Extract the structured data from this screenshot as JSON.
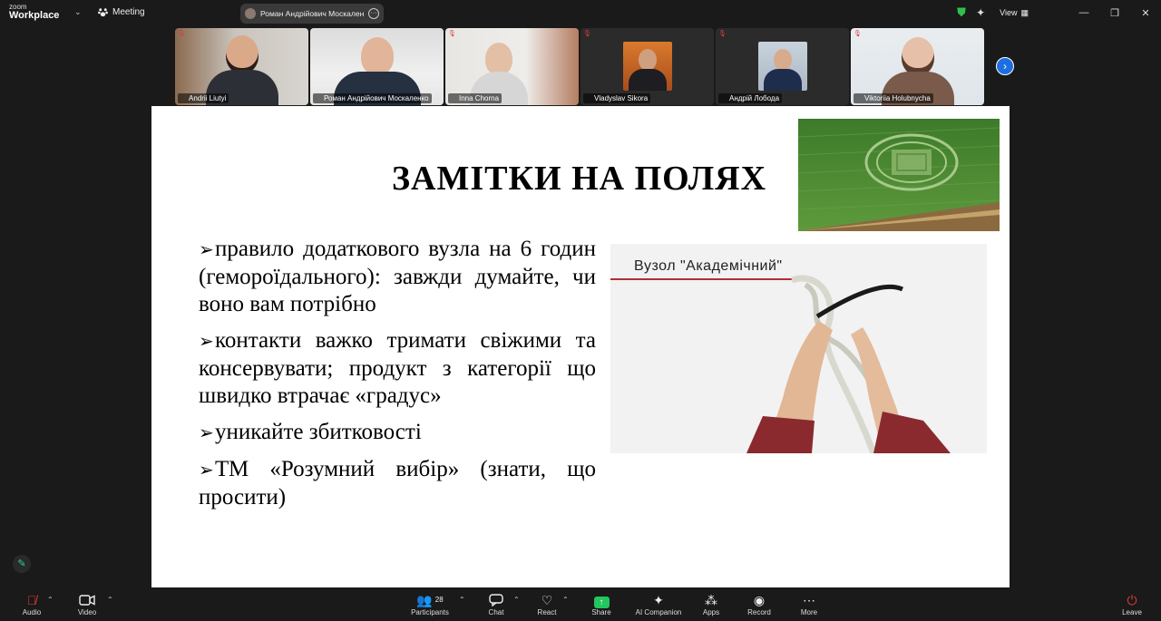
{
  "app": {
    "brand_small": "zoom",
    "brand_large": "Workplace",
    "meeting_label": "Meeting"
  },
  "active_speaker": {
    "name": "Роман Андрійович Москаленко"
  },
  "top_right": {
    "view_label": "View"
  },
  "participants_strip": [
    {
      "name": "Andrii Liutyi",
      "muted": true,
      "active": false
    },
    {
      "name": "Роман Андрійович Москаленко",
      "muted": false,
      "active": true
    },
    {
      "name": "Inna Chorna",
      "muted": true,
      "active": false
    },
    {
      "name": "Vladyslav Sikora",
      "muted": true,
      "active": false
    },
    {
      "name": "Андрій Лобода",
      "muted": true,
      "active": false
    },
    {
      "name": "Viktoriia Holubnycha",
      "muted": true,
      "active": false
    }
  ],
  "slide": {
    "title": "ЗАМІТКИ НА ПОЛЯХ",
    "bullets": [
      "правило додаткового вузла на 6 годин (геморoїдального): завжди думайте, чи воно вам потрібно",
      "контакти важко тримати свіжими та консервувати; продукт з категорії що швидко втрачає «градус»",
      "уникайте збитковості",
      "ТМ «Розумний вибір» (знати, що просити)"
    ],
    "knot_caption": "Вузол \"Академічний\""
  },
  "toolbar": {
    "audio": "Audio",
    "video": "Video",
    "participants": "Participants",
    "participants_count": "28",
    "chat": "Chat",
    "react": "React",
    "share": "Share",
    "ai_companion": "AI Companion",
    "apps": "Apps",
    "record": "Record",
    "more": "More",
    "leave": "Leave"
  },
  "colors": {
    "active_tile": "#2fd38a",
    "share_green": "#22c55e",
    "mute_red": "#e23b3b",
    "next_blue": "#1d6fe0"
  }
}
